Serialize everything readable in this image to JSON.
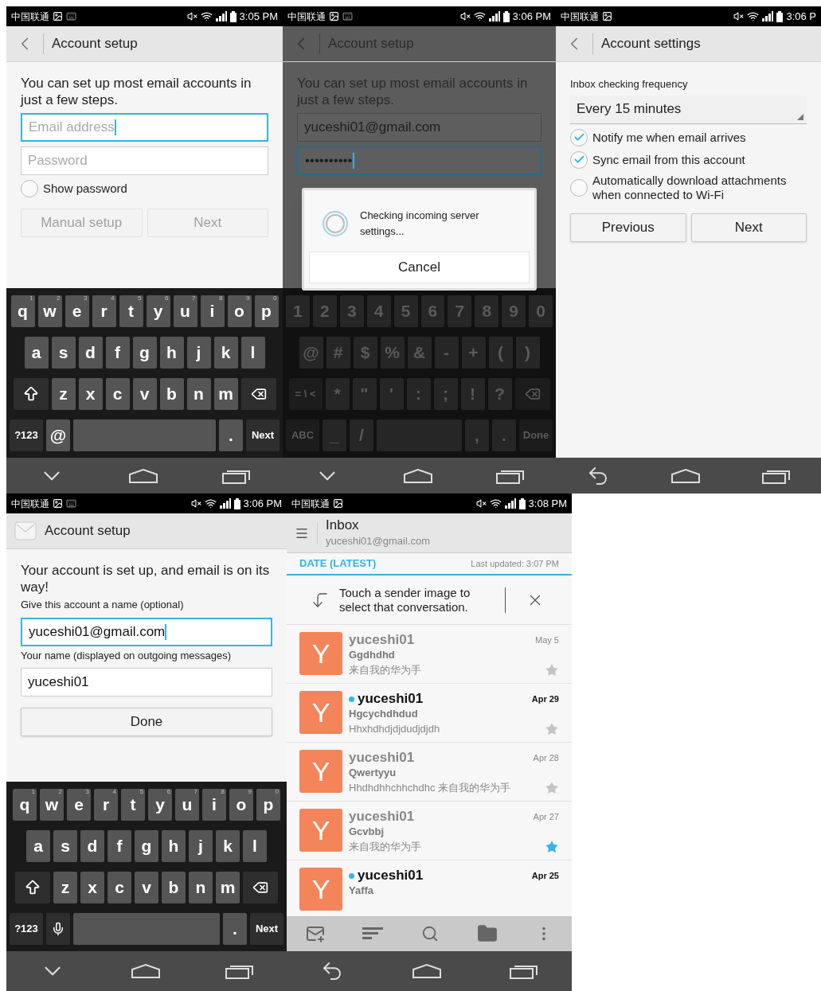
{
  "screens": [
    {
      "kind": "setup",
      "status": {
        "carrier": "中国联通",
        "keyboard_notice": true,
        "time": "3:05 PM"
      },
      "header": {
        "kind": "back",
        "title": "Account setup"
      },
      "dimmed": false,
      "body": [
        {
          "kind": "intro",
          "text": "You can set up most email accounts in just a few steps."
        },
        {
          "kind": "field",
          "placeholder": "Email address",
          "focused": true
        },
        {
          "kind": "field",
          "placeholder": "Password",
          "focused": false
        },
        {
          "kind": "checkbox",
          "label": "Show password",
          "checked": false
        },
        {
          "kind": "buttons",
          "items": [
            {
              "label": "Manual setup",
              "disabled": true
            },
            {
              "label": "Next",
              "disabled": true
            }
          ]
        }
      ],
      "keyboard": {
        "dimmed": false,
        "rows": [
          {
            "keys": [
              {
                "label": "q",
                "hint": "1"
              },
              {
                "label": "w",
                "hint": "2"
              },
              {
                "label": "e",
                "hint": "3"
              },
              {
                "label": "r",
                "hint": "4"
              },
              {
                "label": "t",
                "hint": "5"
              },
              {
                "label": "y",
                "hint": "6"
              },
              {
                "label": "u",
                "hint": "7"
              },
              {
                "label": "i",
                "hint": "8"
              },
              {
                "label": "o",
                "hint": "9"
              },
              {
                "label": "p",
                "hint": "0"
              }
            ]
          },
          {
            "keys": [
              {
                "label": "a"
              },
              {
                "label": "s"
              },
              {
                "label": "d"
              },
              {
                "label": "f"
              },
              {
                "label": "g"
              },
              {
                "label": "h"
              },
              {
                "label": "j"
              },
              {
                "label": "k"
              },
              {
                "label": "l"
              }
            ]
          },
          {
            "keys": [
              {
                "kind": "shift"
              },
              {
                "label": "z"
              },
              {
                "label": "x"
              },
              {
                "label": "c"
              },
              {
                "label": "v"
              },
              {
                "label": "b"
              },
              {
                "label": "n"
              },
              {
                "label": "m"
              },
              {
                "kind": "delete"
              }
            ]
          },
          {
            "keys": [
              {
                "kind": "mode",
                "label": "?123"
              },
              {
                "label": "@"
              },
              {
                "kind": "space"
              },
              {
                "label": "."
              },
              {
                "kind": "action",
                "label": "Next"
              }
            ]
          }
        ]
      },
      "nav": {
        "kind": "keyboard"
      }
    },
    {
      "kind": "setup",
      "status": {
        "carrier": "中国联通",
        "keyboard_notice": true,
        "time": "3:06 PM"
      },
      "header": {
        "kind": "back",
        "title": "Account setup"
      },
      "dimmed": true,
      "body": [
        {
          "kind": "intro",
          "text": "You can set up most email accounts in just a few steps."
        },
        {
          "kind": "field",
          "value": "yuceshi01@gmail.com",
          "focused": false
        },
        {
          "kind": "field",
          "value": "••••••••••",
          "focused": true
        }
      ],
      "dialog": {
        "message": "Checking incoming server settings...",
        "button": "Cancel"
      },
      "keyboard": {
        "dimmed": true,
        "rows": [
          {
            "keys": [
              {
                "label": "1"
              },
              {
                "label": "2"
              },
              {
                "label": "3"
              },
              {
                "label": "4"
              },
              {
                "label": "5"
              },
              {
                "label": "6"
              },
              {
                "label": "7"
              },
              {
                "label": "8"
              },
              {
                "label": "9"
              },
              {
                "label": "0"
              }
            ]
          },
          {
            "keys": [
              {
                "label": "@"
              },
              {
                "label": "#"
              },
              {
                "label": "$"
              },
              {
                "label": "%"
              },
              {
                "label": "&"
              },
              {
                "label": "-"
              },
              {
                "label": "+"
              },
              {
                "label": "("
              },
              {
                "label": ")"
              }
            ]
          },
          {
            "keys": [
              {
                "kind": "mode",
                "label": "= \\ <"
              },
              {
                "label": "*"
              },
              {
                "label": "\""
              },
              {
                "label": "'"
              },
              {
                "label": ":"
              },
              {
                "label": ";"
              },
              {
                "label": "!"
              },
              {
                "label": "?"
              },
              {
                "kind": "delete"
              }
            ]
          },
          {
            "keys": [
              {
                "kind": "mode",
                "label": "ABC"
              },
              {
                "label": "_"
              },
              {
                "label": "/"
              },
              {
                "kind": "space"
              },
              {
                "label": ","
              },
              {
                "label": "."
              },
              {
                "kind": "action",
                "label": "Done"
              }
            ]
          }
        ]
      },
      "nav": {
        "kind": "keyboard"
      }
    },
    {
      "kind": "setup",
      "status": {
        "carrier": "中国联通",
        "keyboard_notice": false,
        "time": "3:06 P"
      },
      "header": {
        "kind": "back",
        "title": "Account settings"
      },
      "dimmed": false,
      "body": [
        {
          "kind": "label",
          "text": "Inbox checking frequency"
        },
        {
          "kind": "select",
          "value": "Every 15 minutes"
        },
        {
          "kind": "checkbox",
          "label": "Notify me when email arrives",
          "checked": true
        },
        {
          "kind": "checkbox",
          "label": "Sync email from this account",
          "checked": true
        },
        {
          "kind": "checkbox",
          "label": "Automatically download attachments when connected to Wi-Fi",
          "checked": false
        },
        {
          "kind": "buttons",
          "items": [
            {
              "label": "Previous",
              "disabled": false
            },
            {
              "label": "Next",
              "disabled": false
            }
          ]
        }
      ],
      "nav": {
        "kind": "back"
      }
    },
    {
      "kind": "setup",
      "status": {
        "carrier": "中国联通",
        "keyboard_notice": true,
        "time": "3:06 PM"
      },
      "header": {
        "kind": "app",
        "title": "Account setup"
      },
      "dimmed": false,
      "body": [
        {
          "kind": "intro",
          "text": "Your account is set up, and email is on its way!"
        },
        {
          "kind": "label",
          "text": "Give this account a name (optional)"
        },
        {
          "kind": "field",
          "value": "yuceshi01@gmail.com",
          "focused": true
        },
        {
          "kind": "label",
          "text": "Your name (displayed on outgoing messages)"
        },
        {
          "kind": "field",
          "value": "yuceshi01",
          "focused": false
        },
        {
          "kind": "buttons",
          "items": [
            {
              "label": "Done",
              "disabled": false
            }
          ]
        }
      ],
      "keyboard": {
        "dimmed": false,
        "rows": [
          {
            "keys": [
              {
                "label": "q",
                "hint": "1"
              },
              {
                "label": "w",
                "hint": "2"
              },
              {
                "label": "e",
                "hint": "3"
              },
              {
                "label": "r",
                "hint": "4"
              },
              {
                "label": "t",
                "hint": "5"
              },
              {
                "label": "y",
                "hint": "6"
              },
              {
                "label": "u",
                "hint": "7"
              },
              {
                "label": "i",
                "hint": "8"
              },
              {
                "label": "o",
                "hint": "9"
              },
              {
                "label": "p",
                "hint": "0"
              }
            ]
          },
          {
            "keys": [
              {
                "label": "a"
              },
              {
                "label": "s"
              },
              {
                "label": "d"
              },
              {
                "label": "f"
              },
              {
                "label": "g"
              },
              {
                "label": "h"
              },
              {
                "label": "j"
              },
              {
                "label": "k"
              },
              {
                "label": "l"
              }
            ]
          },
          {
            "keys": [
              {
                "kind": "shift"
              },
              {
                "label": "z"
              },
              {
                "label": "x"
              },
              {
                "label": "c"
              },
              {
                "label": "v"
              },
              {
                "label": "b"
              },
              {
                "label": "n"
              },
              {
                "label": "m"
              },
              {
                "kind": "delete"
              }
            ]
          },
          {
            "keys": [
              {
                "kind": "mode",
                "label": "?123"
              },
              {
                "kind": "mic"
              },
              {
                "kind": "space"
              },
              {
                "label": "."
              },
              {
                "kind": "action",
                "label": "Next"
              }
            ]
          }
        ]
      },
      "nav": {
        "kind": "keyboard"
      }
    },
    {
      "kind": "inbox",
      "status": {
        "carrier": "中国联通",
        "keyboard_notice": false,
        "time": "3:08 PM"
      },
      "header": {
        "kind": "menu",
        "title": "Inbox",
        "subtitle": "yuceshi01@gmail.com"
      },
      "sort": {
        "label": "DATE (LATEST)",
        "updated": "Last updated: 3:07 PM"
      },
      "tip": "Touch a sender image to select that conversation.",
      "messages": [
        {
          "avatar": "Y",
          "sender": "yuceshi01",
          "unread": false,
          "date": "May 5",
          "subject": "Ggdhdhd",
          "snippet": "来自我的华为手",
          "starred": false
        },
        {
          "avatar": "Y",
          "sender": "yuceshi01",
          "unread": true,
          "date": "Apr 29",
          "subject": "Hgcychdhdud",
          "snippet": "Hhxhdhdjdjdudjdjdh",
          "starred": false
        },
        {
          "avatar": "Y",
          "sender": "yuceshi01",
          "unread": false,
          "date": "Apr 28",
          "subject": "Qwertyyu",
          "snippet": "Hhdhdhhchhchdhc 来自我的华为手",
          "starred": false
        },
        {
          "avatar": "Y",
          "sender": "yuceshi01",
          "unread": false,
          "date": "Apr 27",
          "subject": "Gcvbbj",
          "snippet": "来自我的华为手",
          "starred": true
        },
        {
          "avatar": "Y",
          "sender": "yuceshi01",
          "unread": true,
          "date": "Apr 25",
          "subject": "Yaffa"
        }
      ],
      "nav": {
        "kind": "back"
      }
    }
  ]
}
